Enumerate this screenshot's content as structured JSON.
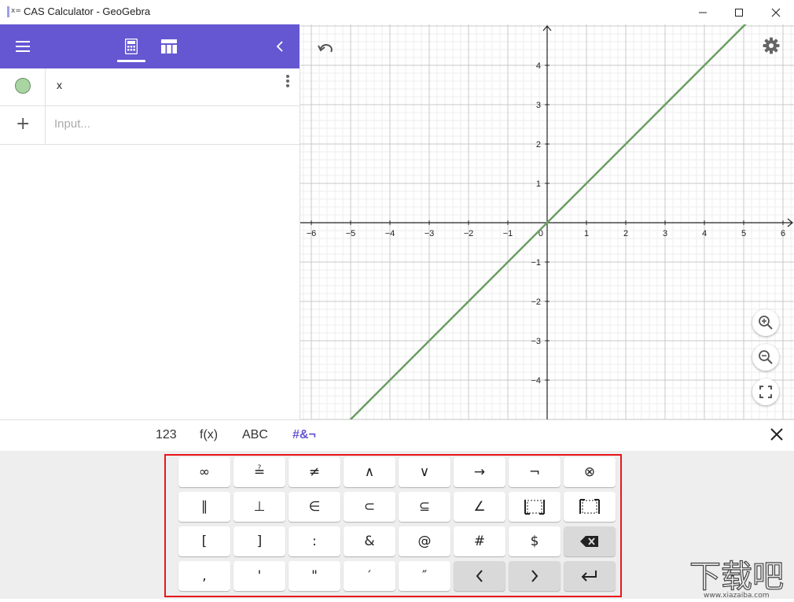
{
  "window": {
    "title": "CAS Calculator - GeoGebra",
    "icon_text": "x="
  },
  "toolbar": {
    "accent": "#6557d2",
    "icons": [
      "menu-icon",
      "calculator-icon",
      "table-icon",
      "chevron-left-icon"
    ]
  },
  "algebra": {
    "rows": [
      {
        "expression": "x",
        "marble_color": "#a8d5a2"
      }
    ],
    "input_placeholder": "Input..."
  },
  "graph": {
    "x_ticks": [
      "−6",
      "−5",
      "−4",
      "−3",
      "−2",
      "−1",
      "0",
      "1",
      "2",
      "3",
      "4",
      "5",
      "6"
    ],
    "y_ticks": [
      "4",
      "3",
      "2",
      "1",
      "−1",
      "−2",
      "−3",
      "−4"
    ],
    "line_color": "#6b9e63",
    "function": "y = x",
    "icons": [
      "undo-icon",
      "gear-icon",
      "zoom-in-icon",
      "zoom-out-icon",
      "fullscreen-icon"
    ]
  },
  "keyboard": {
    "tabs": [
      "123",
      "f(x)",
      "ABC",
      "#&¬"
    ],
    "active_tab": "#&¬",
    "keys": [
      [
        "∞",
        "≟",
        "≠",
        "∧",
        "∨",
        "→",
        "¬",
        "⊗"
      ],
      [
        "∥",
        "⊥",
        "∈",
        "⊂",
        "⊆",
        "∠",
        "",
        ""
      ],
      [
        "[",
        "]",
        ":",
        "&",
        "@",
        "#",
        "$",
        ""
      ],
      [
        ",",
        "'",
        "\"",
        "′",
        "″",
        "",
        "",
        ""
      ]
    ],
    "special_keys": [
      "backspace-icon",
      "arrow-left-icon",
      "arrow-right-icon",
      "enter-icon"
    ],
    "highlight_color": "#e8161b"
  },
  "watermark": {
    "text": "下载吧",
    "url": "www.xiazaiba.com"
  }
}
